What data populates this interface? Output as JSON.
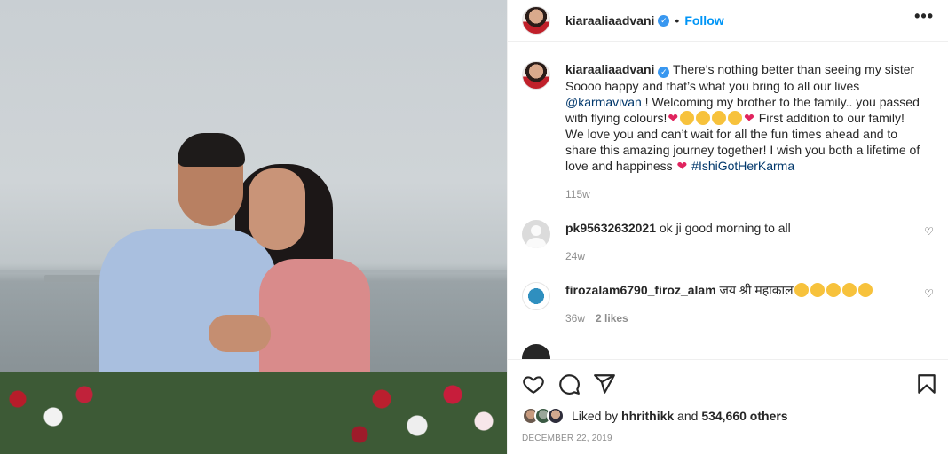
{
  "post": {
    "username": "kiaraaliaadvani",
    "follow_label": "Follow",
    "dot": "•",
    "more_label": "•••",
    "verified_mark": "✓"
  },
  "caption": {
    "username": "kiaraaliaadvani",
    "text_1": " There’s nothing better than seeing my sister Soooo happy and that’s what you bring to all our lives ",
    "mention": "@karmavivan",
    "text_2": " ! Welcoming my brother to the family.. you passed with flying colours!",
    "text_3": " First addition to our family! We love you and can’t wait for all the fun times ahead and to share this amazing journey together! I wish you both a lifetime of love and happiness ",
    "hashtag": "#IshiGotHerKarma",
    "heart": "❤",
    "time": "115w"
  },
  "comments": [
    {
      "username": "pk95632632021",
      "text": " ok ji good morning to all",
      "time": "24w",
      "likes": ""
    },
    {
      "username": "firozalam6790_firoz_alam",
      "text": " जय श्री महाकाल",
      "time": "36w",
      "likes": "2 likes"
    }
  ],
  "comment_heart": "♡",
  "liked_by": {
    "prefix": "Liked by ",
    "user": "hhrithikk",
    "middle": " and ",
    "count": "534,660 others"
  },
  "date": "DECEMBER 22, 2019",
  "icons": {
    "like": "heart-icon",
    "comment": "comment-icon",
    "share": "share-icon",
    "save": "bookmark-icon"
  }
}
